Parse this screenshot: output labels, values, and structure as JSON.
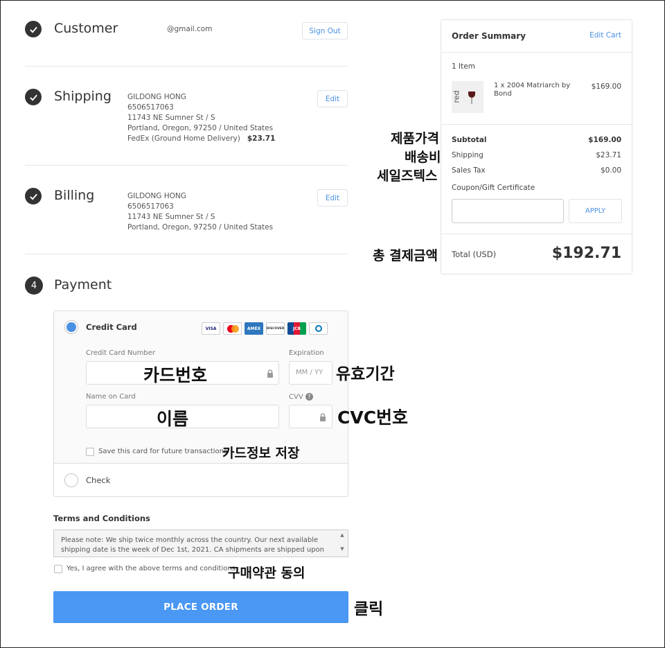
{
  "customer": {
    "title": "Customer",
    "email": "@gmail.com",
    "sign_out": "Sign Out"
  },
  "shipping": {
    "title": "Shipping",
    "name": "GILDONG HONG",
    "phone": "6506517063",
    "street": "11743 NE Sumner St / S",
    "city": "Portland, Oregon, 97250 / United States",
    "method": "FedEx (Ground Home Delivery)",
    "method_price": "$23.71",
    "edit": "Edit"
  },
  "billing": {
    "title": "Billing",
    "name": "GILDONG HONG",
    "phone": "6506517063",
    "street": "11743 NE Sumner St / S",
    "city": "Portland, Oregon, 97250 / United States",
    "edit": "Edit"
  },
  "payment": {
    "step_number": "4",
    "title": "Payment",
    "credit_card_label": "Credit Card",
    "card_logos": [
      "VISA",
      "MC",
      "AMEX",
      "DISCOVER",
      "JCB",
      "DINERS"
    ],
    "card_number_label": "Credit Card Number",
    "expiration_label": "Expiration",
    "expiration_placeholder": "MM / YY",
    "name_label": "Name on Card",
    "cvv_label": "CVV",
    "save_card_label": "Save this card for future transactions",
    "check_label": "Check"
  },
  "terms": {
    "heading": "Terms and Conditions",
    "text": "Please note:  We ship twice monthly across the country.  Our next available shipping date is the week of Dec 1st, 2021.  CA shipments are shipped upon",
    "agree_label": "Yes, I agree with the above terms and conditions."
  },
  "place_order": "PLACE ORDER",
  "summary": {
    "title": "Order Summary",
    "edit_cart": "Edit Cart",
    "item_count": "1 Item",
    "item_line1": "1 x 2004 Matriarch by",
    "item_line2": "Bond",
    "item_price": "$169.00",
    "item_thumb_text": "red",
    "subtotal_label": "Subtotal",
    "subtotal": "$169.00",
    "shipping_label": "Shipping",
    "shipping": "$23.71",
    "tax_label": "Sales Tax",
    "tax": "$0.00",
    "coupon_label": "Coupon/Gift Certificate",
    "apply": "APPLY",
    "total_label": "Total (USD)",
    "total": "$192.71"
  },
  "annotations": {
    "product_price": "제품가격",
    "shipping_fee": "배송비",
    "sales_tax": "세일즈텍스",
    "total_payment": "총 결제금액",
    "card_number": "카드번호",
    "expiry": "유효기간",
    "name": "이름",
    "cvc": "CVC번호",
    "save_card": "카드정보 저장",
    "agree_terms": "구매약관 동의",
    "click": "클릭"
  }
}
